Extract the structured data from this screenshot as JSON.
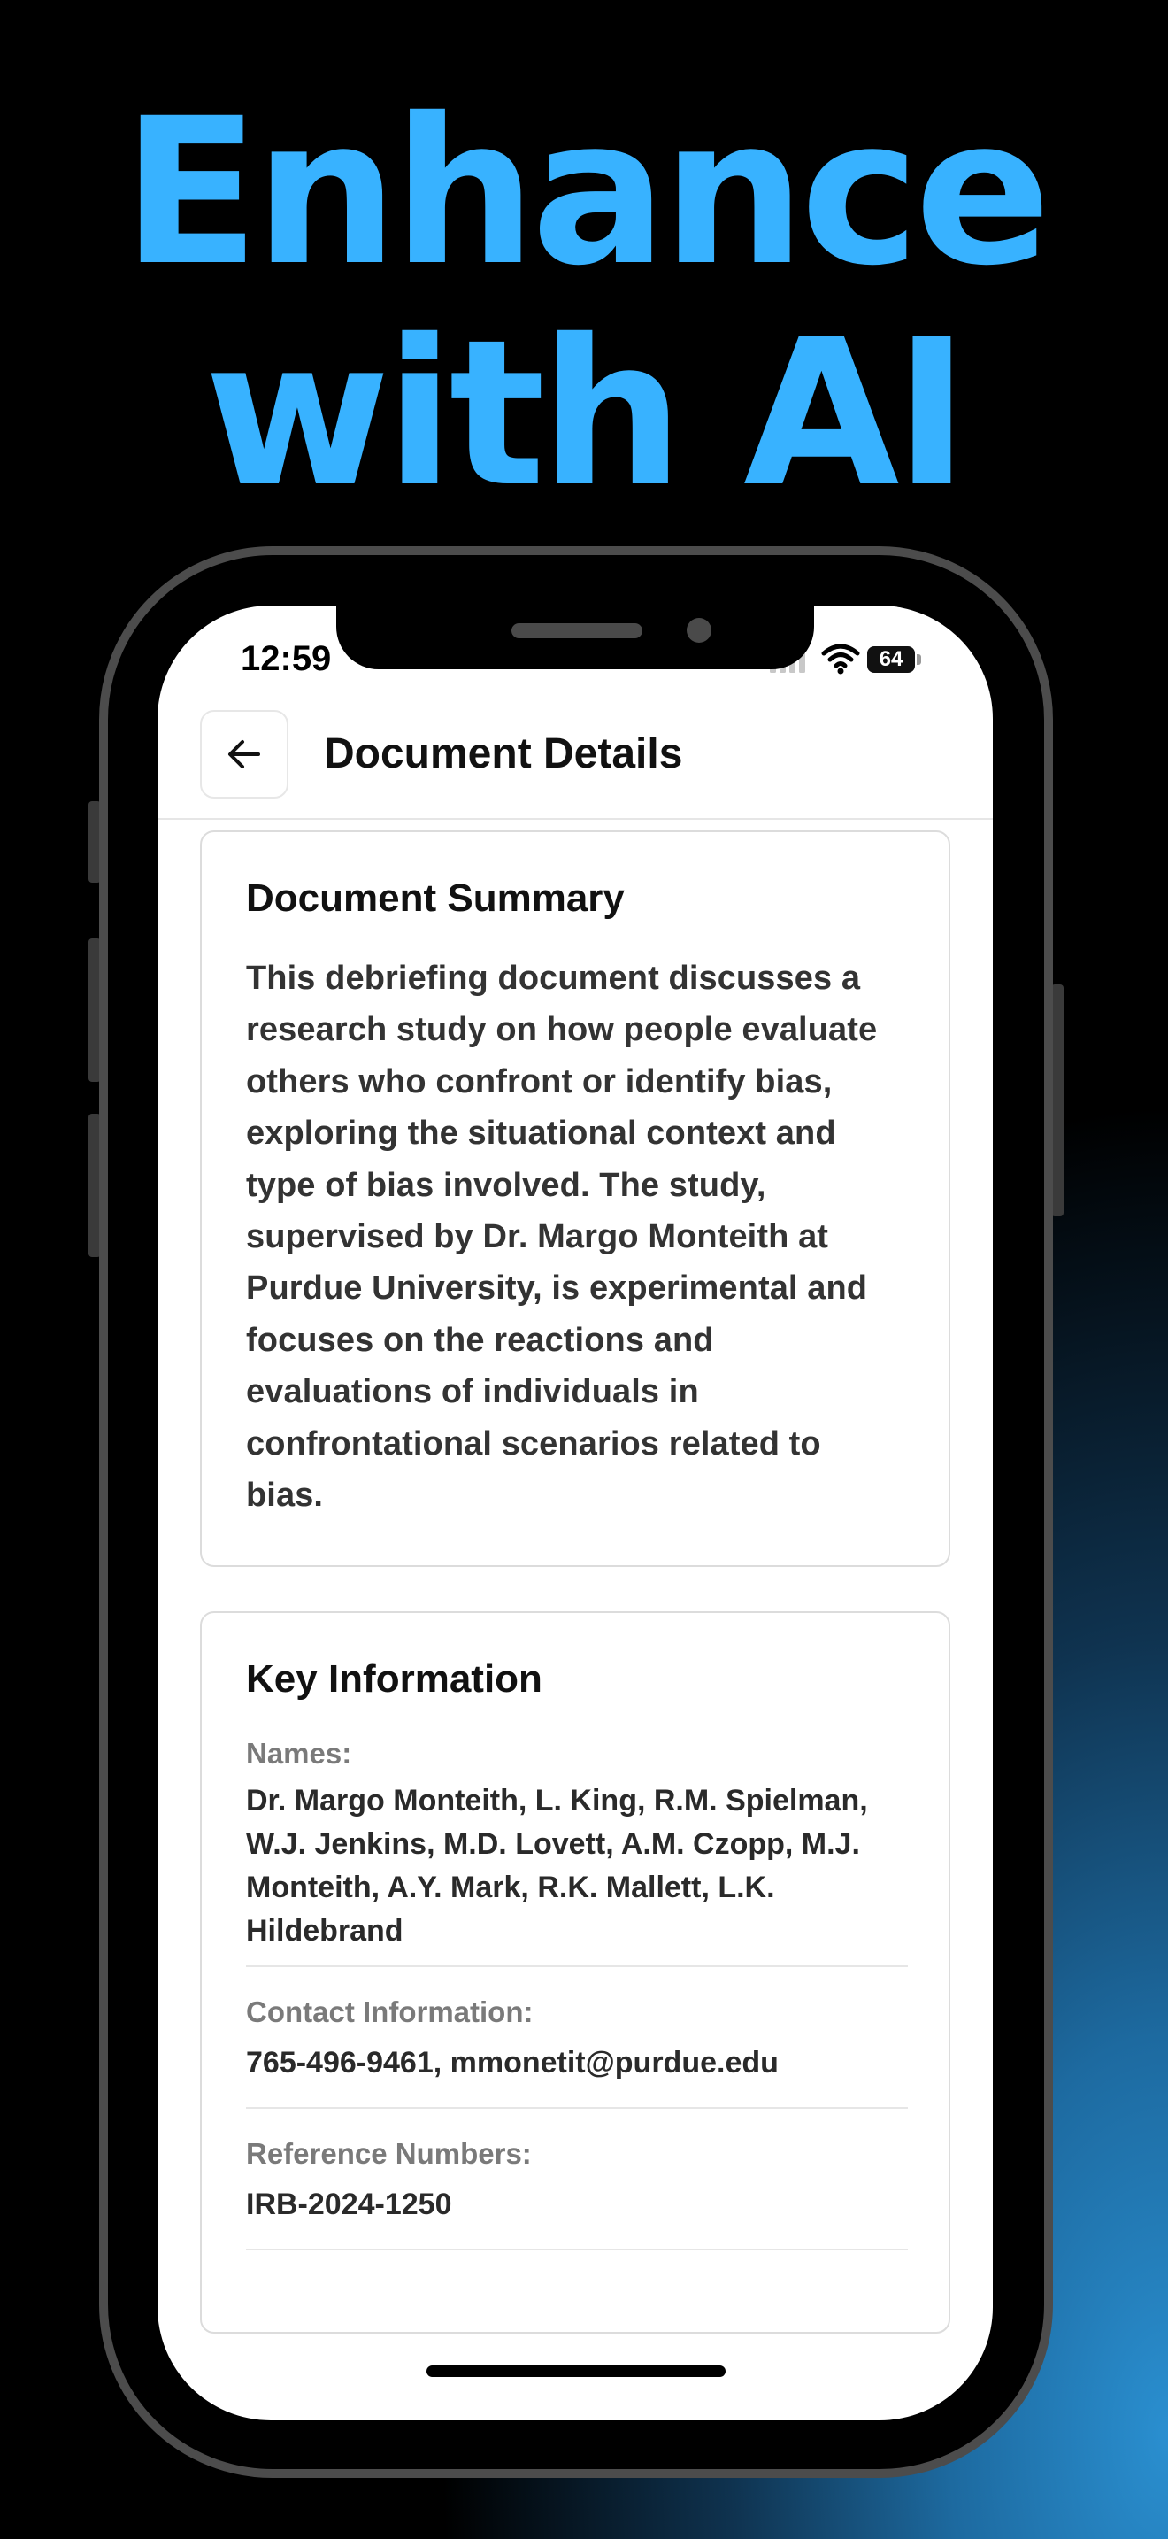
{
  "headline": {
    "line1": "Enhance",
    "line2": "with AI"
  },
  "status_bar": {
    "time": "12:59",
    "battery": "64"
  },
  "nav": {
    "back_icon": "arrow-left-icon",
    "title": "Document Details"
  },
  "summary": {
    "heading": "Document Summary",
    "lines": [
      "This debriefing document discusses a",
      "research study on how people evaluate",
      "others who confront or identify bias,",
      "exploring the situational context and",
      "type of bias involved. The study,",
      "supervised by Dr. Margo Monteith at",
      "Purdue University, is experimental and",
      "focuses on the reactions and",
      "evaluations of individuals in",
      "confrontational scenarios related to",
      "bias."
    ]
  },
  "key_info": {
    "heading": "Key Information",
    "names": {
      "label": "Names:",
      "lines": [
        "Dr. Margo Monteith, L. King, R.M. Spielman,",
        "W.J. Jenkins, M.D. Lovett, A.M. Czopp, M.J.",
        "Monteith, A.Y. Mark, R.K. Mallett, L.K.",
        "Hildebrand"
      ]
    },
    "contact": {
      "label": "Contact Information:",
      "value": "765-496-9461, mmonetit@purdue.edu"
    },
    "reference": {
      "label": "Reference Numbers:",
      "value": "IRB-2024-1250"
    }
  },
  "colors": {
    "headline": "#38b2ff",
    "background": "#000000",
    "glow": "#2a8fd0"
  }
}
